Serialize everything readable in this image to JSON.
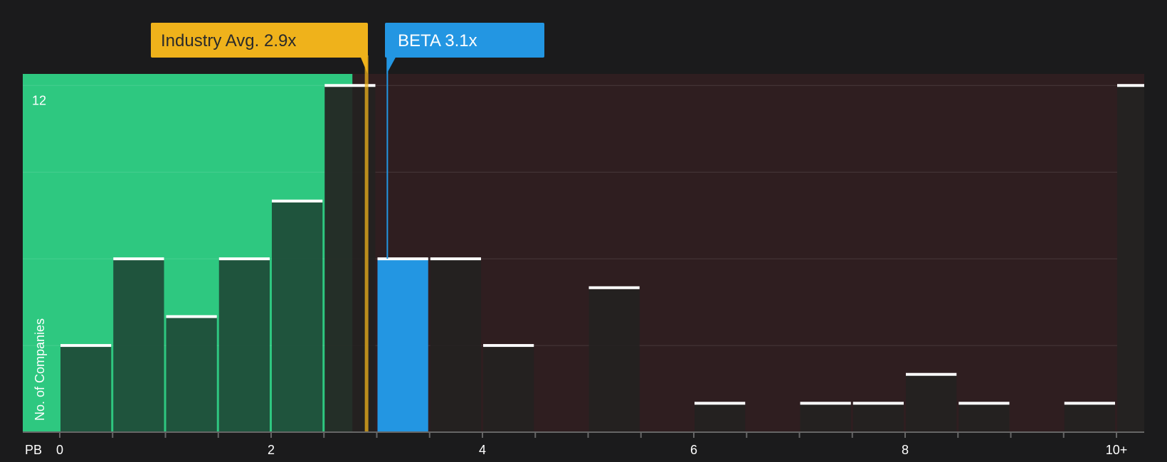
{
  "chart_data": {
    "type": "bar",
    "xlabel": "PB",
    "ylabel": "No. of Companies",
    "y_tick_label": "12",
    "ylim": [
      0,
      12.4
    ],
    "x_ticks": [
      {
        "value": 0,
        "label": "0"
      },
      {
        "value": 2,
        "label": "2"
      },
      {
        "value": 4,
        "label": "4"
      },
      {
        "value": 6,
        "label": "6"
      },
      {
        "value": 8,
        "label": "8"
      },
      {
        "value": 10,
        "label": "10+"
      }
    ],
    "bin_width": 0.5,
    "bins": [
      {
        "start": 0.0,
        "count": 3
      },
      {
        "start": 0.5,
        "count": 6
      },
      {
        "start": 1.0,
        "count": 4
      },
      {
        "start": 1.5,
        "count": 6
      },
      {
        "start": 2.0,
        "count": 8
      },
      {
        "start": 2.5,
        "count": 12
      },
      {
        "start": 3.0,
        "count": 6,
        "highlight": true
      },
      {
        "start": 3.5,
        "count": 6
      },
      {
        "start": 4.0,
        "count": 3
      },
      {
        "start": 4.5,
        "count": 0
      },
      {
        "start": 5.0,
        "count": 5
      },
      {
        "start": 5.5,
        "count": 0
      },
      {
        "start": 6.0,
        "count": 1
      },
      {
        "start": 6.5,
        "count": 0
      },
      {
        "start": 7.0,
        "count": 1
      },
      {
        "start": 7.5,
        "count": 1
      },
      {
        "start": 8.0,
        "count": 2
      },
      {
        "start": 8.5,
        "count": 1
      },
      {
        "start": 9.0,
        "count": 0
      },
      {
        "start": 9.5,
        "count": 1
      },
      {
        "start": 10.0,
        "count": 12
      }
    ],
    "industry_avg": {
      "label": "Industry Avg. 2.9x",
      "value": 2.9
    },
    "company": {
      "label": "BETA 3.1x",
      "value": 3.1
    },
    "grid": true
  },
  "colors": {
    "background": "#1b1b1c",
    "undervalued_zone": "#2ec880",
    "overvalued_zone": "#2f1e20",
    "bar_on_green": "#1e4a37",
    "bar_dark": "#242221",
    "highlight_bar": "#2396e2",
    "industry": "#efb21b",
    "company": "#2396e2",
    "cap_line": "#ffffff"
  }
}
